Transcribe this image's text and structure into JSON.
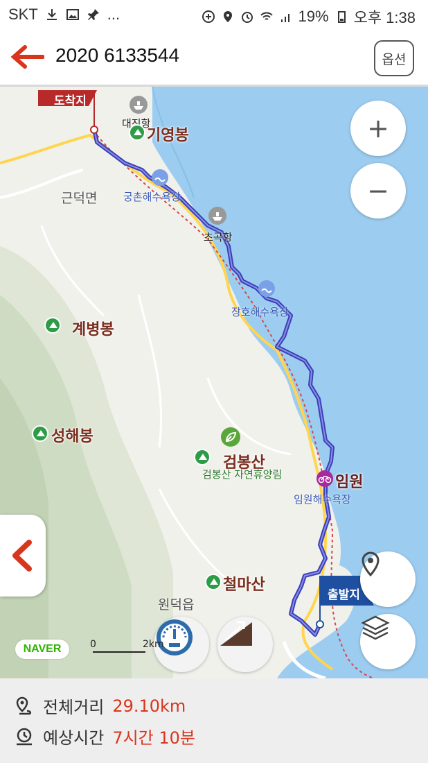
{
  "status_bar": {
    "carrier": "SKT",
    "more": "...",
    "battery": "19%",
    "time": "오후 1:38"
  },
  "header": {
    "title": "2020 6133544",
    "options_label": "옵션"
  },
  "map": {
    "flags": {
      "arrival": "도착지",
      "departure": "출발지"
    },
    "peaks": [
      "기영봉",
      "계병봉",
      "성해봉",
      "검봉산",
      "철마산"
    ],
    "towns": [
      "근덕면",
      "원덕읍",
      "임원"
    ],
    "beaches": [
      "궁촌해수욕장",
      "장호해수욕장",
      "임원해수욕장"
    ],
    "ports": [
      "대진항",
      "초곡항"
    ],
    "park": "검봉산 자연휴양림",
    "naver_logo": "NAVER",
    "scale_start": "0",
    "scale_end": "2km",
    "colors": {
      "sea": "#9ccdf0",
      "route": "#3a3fb8",
      "accent": "#d9341c"
    }
  },
  "footer": {
    "distance_label": "전체거리",
    "distance_value": "29.10km",
    "time_label": "예상시간",
    "time_value": "7시간 10분"
  }
}
